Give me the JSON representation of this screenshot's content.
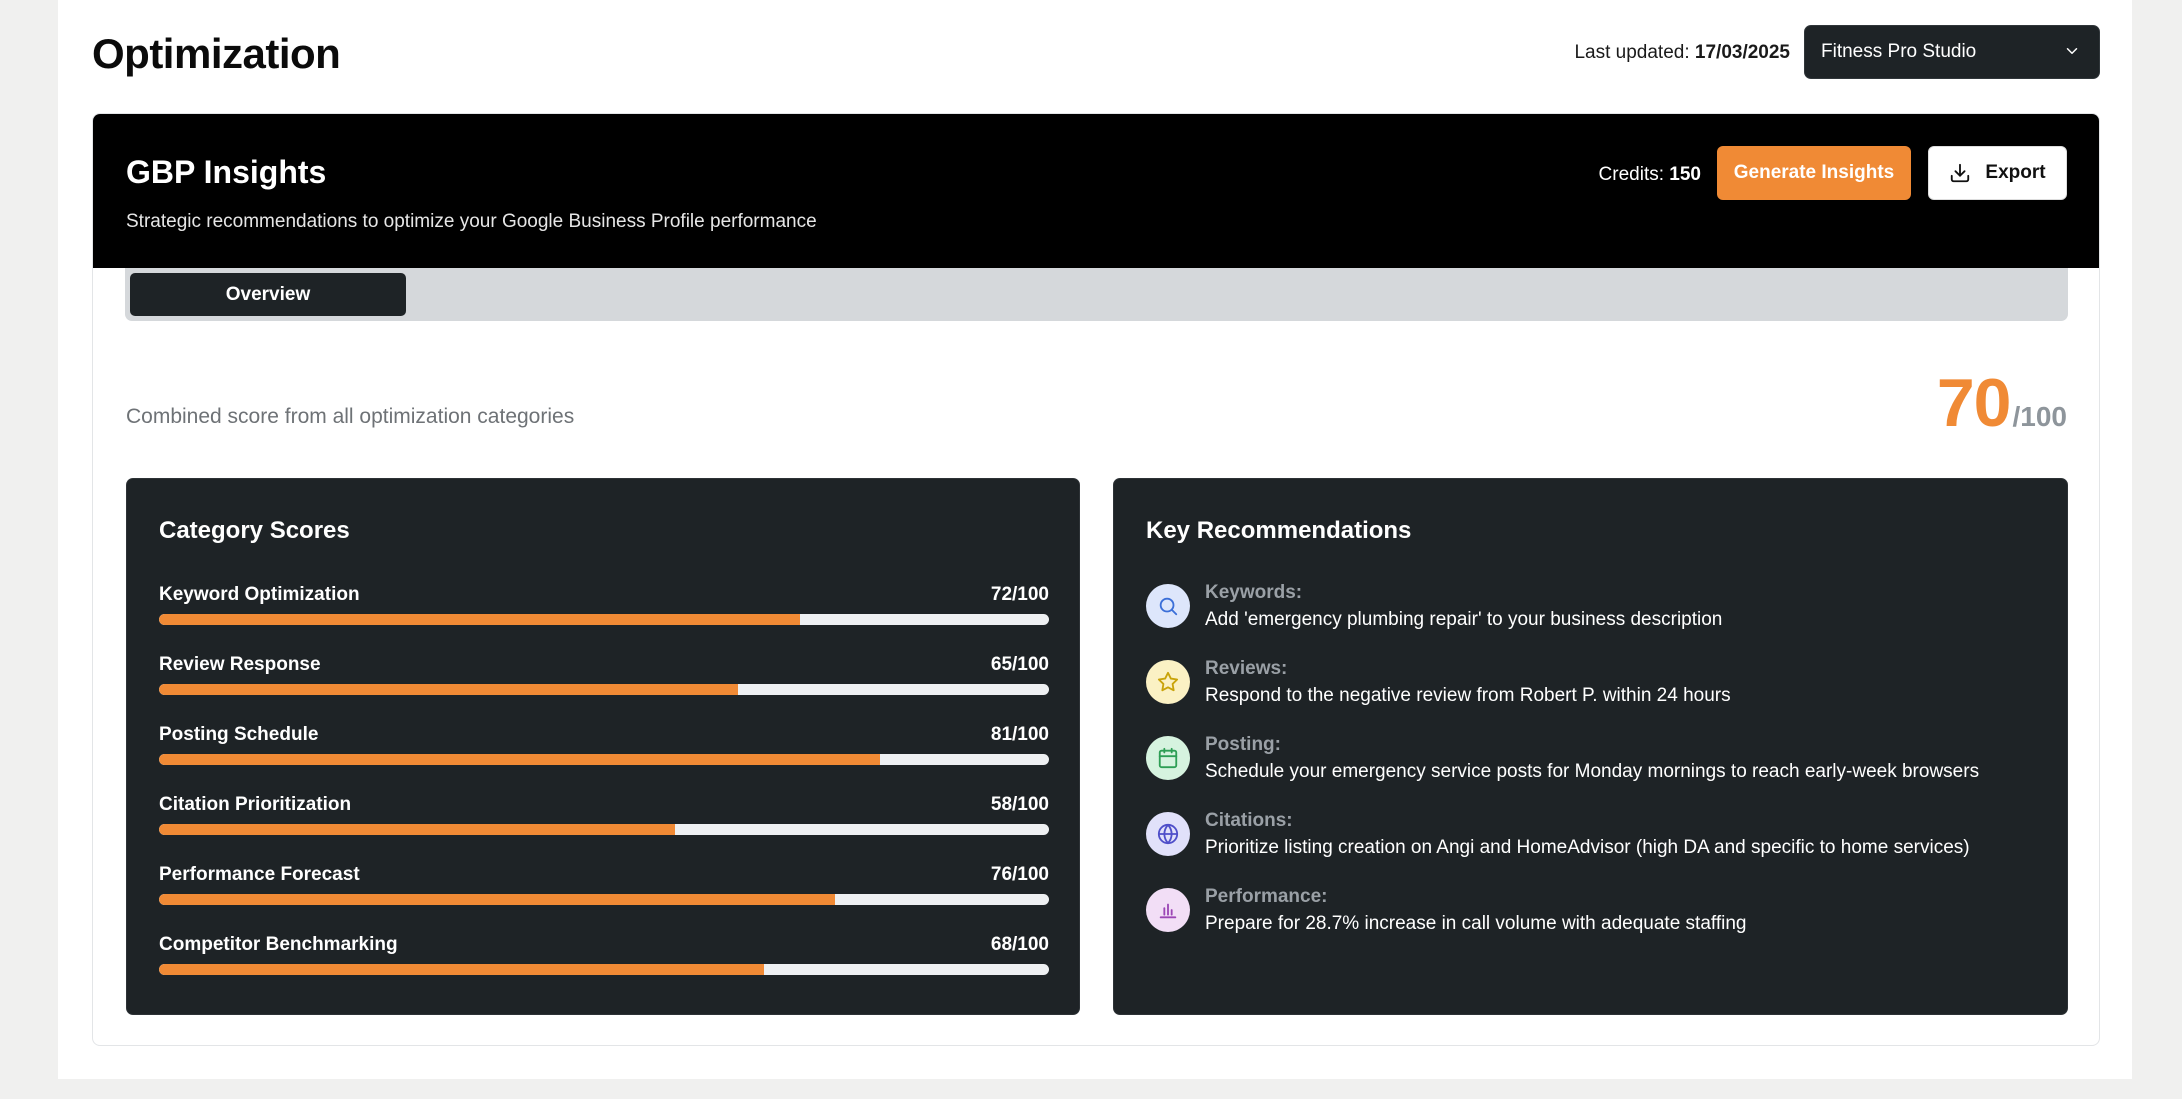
{
  "header": {
    "title": "Optimization",
    "last_updated_label": "Last updated:",
    "last_updated_value": "17/03/2025",
    "business_select": "Fitness Pro Studio"
  },
  "banner": {
    "title": "GBP Insights",
    "subtitle": "Strategic recommendations to optimize your Google Business Profile performance",
    "credits_label": "Credits:",
    "credits_value": "150",
    "generate_label": "Generate Insights",
    "export_label": "Export"
  },
  "tabs": [
    {
      "label": "Overview",
      "active": true
    }
  ],
  "overview": {
    "combined_label": "Combined score from all optimization categories",
    "score": "70",
    "score_max": "/100"
  },
  "category_scores": {
    "title": "Category Scores",
    "items": [
      {
        "label": "Keyword Optimization",
        "score_text": "72/100",
        "score": 72
      },
      {
        "label": "Review Response",
        "score_text": "65/100",
        "score": 65
      },
      {
        "label": "Posting Schedule",
        "score_text": "81/100",
        "score": 81
      },
      {
        "label": "Citation Prioritization",
        "score_text": "58/100",
        "score": 58
      },
      {
        "label": "Performance Forecast",
        "score_text": "76/100",
        "score": 76
      },
      {
        "label": "Competitor Benchmarking",
        "score_text": "68/100",
        "score": 68
      }
    ]
  },
  "recommendations": {
    "title": "Key Recommendations",
    "items": [
      {
        "category": "Keywords:",
        "text": "Add 'emergency plumbing repair' to your business description",
        "icon": "search-icon",
        "icon_bg": "#dde6fb",
        "icon_color": "#3b6fd8"
      },
      {
        "category": "Reviews:",
        "text": "Respond to the negative review from Robert P. within 24 hours",
        "icon": "star-icon",
        "icon_bg": "#fbf1c4",
        "icon_color": "#c9a30a"
      },
      {
        "category": "Posting:",
        "text": "Schedule your emergency service posts for Monday mornings to reach early-week browsers",
        "icon": "calendar-icon",
        "icon_bg": "#d6f3df",
        "icon_color": "#2e9e55"
      },
      {
        "category": "Citations:",
        "text": "Prioritize listing creation on Angi and HomeAdvisor (high DA and specific to home services)",
        "icon": "globe-icon",
        "icon_bg": "#e1e1fa",
        "icon_color": "#4f4fc9"
      },
      {
        "category": "Performance:",
        "text": "Prepare for 28.7% increase in call volume with adequate staffing",
        "icon": "bar-chart-icon",
        "icon_bg": "#f2def6",
        "icon_color": "#9b45b5"
      }
    ]
  },
  "colors": {
    "accent": "#f08a35",
    "panel": "#1e2326",
    "banner": "#000000"
  }
}
